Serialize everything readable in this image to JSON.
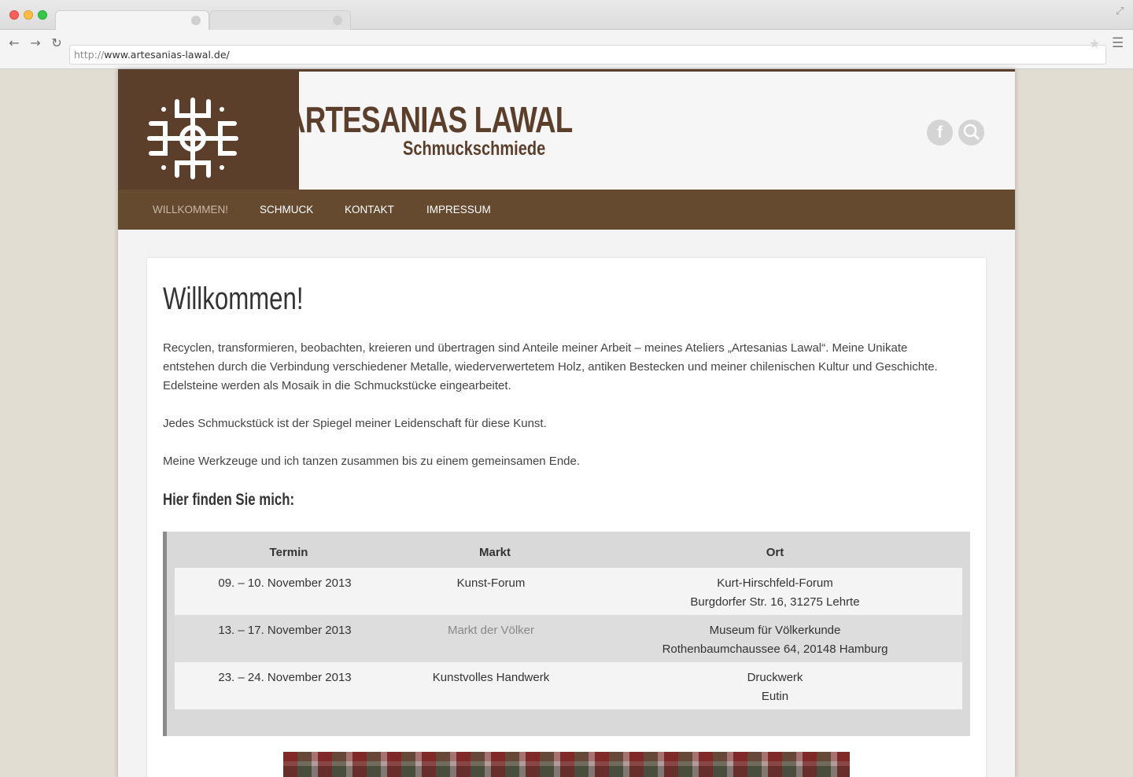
{
  "browser": {
    "url_protocol": "http://",
    "url_host": "www.artesanias-lawal.de/"
  },
  "header": {
    "title": "ARTESANIAS LAWAL",
    "subtitle": "Schmuckschmiede",
    "facebook_label": "f"
  },
  "nav": {
    "items": [
      {
        "label": "WILLKOMMEN!"
      },
      {
        "label": "SCHMUCK"
      },
      {
        "label": "KONTAKT"
      },
      {
        "label": "IMPRESSUM"
      }
    ]
  },
  "content": {
    "title": "Willkommen!",
    "paragraphs": [
      "Recyclen, transformieren, beobachten, kreieren und übertragen sind Anteile meiner Arbeit – meines Ateliers „Artesanias Lawal“. Meine Unikate entstehen durch die Verbindung verschiedener Metalle, wiederverwertetem Holz, antiken Bestecken und meiner chilenischen Kultur und Geschichte. Edelsteine werden als Mosaik in die Schmuckstücke eingearbeitet.",
      "Jedes Schmuckstück ist der Spiegel meiner Leidenschaft für diese Kunst.",
      "Meine Werkzeuge und ich tanzen zusammen bis zu einem gemeinsamen Ende."
    ],
    "subheading": "Hier finden Sie mich:"
  },
  "table": {
    "headers": {
      "termin": "Termin",
      "markt": "Markt",
      "ort": "Ort"
    },
    "rows": [
      {
        "termin": "09. – 10. November 2013",
        "markt": "Kunst-Forum",
        "ort1": "Kurt-Hirschfeld-Forum",
        "ort2": "Burgdorfer Str. 16, 31275 Lehrte"
      },
      {
        "termin": "13. – 17. November 2013",
        "markt": "Markt der Völker",
        "ort1": "Museum für Völkerkunde",
        "ort2": "Rothenbaumchaussee 64, 20148 Hamburg"
      },
      {
        "termin": "23. – 24. November 2013",
        "markt": "Kunstvolles Handwerk",
        "ort1": "Druckwerk",
        "ort2": "Eutin"
      }
    ]
  },
  "colors": {
    "brand_brown": "#5b3f2b",
    "nav_brown": "#654a30",
    "current_nav": "#c9b8a4"
  }
}
